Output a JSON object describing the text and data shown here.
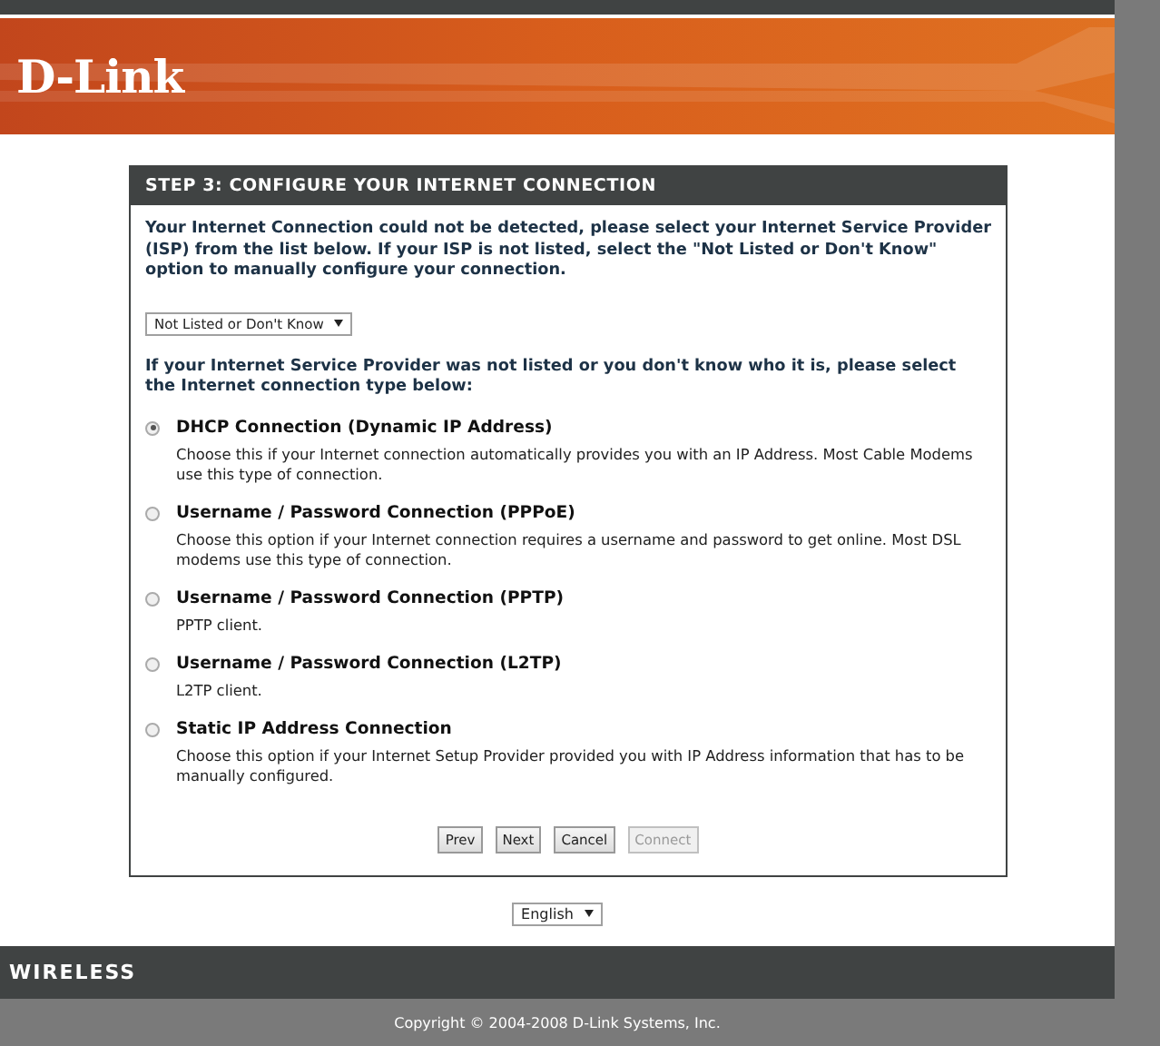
{
  "header": {
    "logo": "D-Link"
  },
  "panel": {
    "title": "STEP 3: CONFIGURE YOUR INTERNET CONNECTION",
    "intro": "Your Internet Connection could not be detected, please select your Internet Service Provider (ISP) from the list below. If your ISP is not listed, select the \"Not Listed or Don't Know\" option to manually configure your connection.",
    "isp_select": {
      "value": "Not Listed or Don't Know"
    },
    "prompt": "If your Internet Service Provider was not listed or you don't know who it is, please select the Internet connection type below:",
    "options": [
      {
        "label": "DHCP Connection (Dynamic IP Address)",
        "description": "Choose this if your Internet connection automatically provides you with an IP Address. Most Cable Modems use this type of connection.",
        "selected": true
      },
      {
        "label": "Username / Password Connection (PPPoE)",
        "description": "Choose this option if your Internet connection requires a username and password to get online. Most DSL modems use this type of connection.",
        "selected": false
      },
      {
        "label": "Username / Password Connection (PPTP)",
        "description": "PPTP client.",
        "selected": false
      },
      {
        "label": "Username / Password Connection (L2TP)",
        "description": "L2TP client.",
        "selected": false
      },
      {
        "label": "Static IP Address Connection",
        "description": "Choose this option if your Internet Setup Provider provided you with IP Address information that has to be manually configured.",
        "selected": false
      }
    ],
    "buttons": [
      {
        "label": "Prev",
        "disabled": false
      },
      {
        "label": "Next",
        "disabled": false
      },
      {
        "label": "Cancel",
        "disabled": false
      },
      {
        "label": "Connect",
        "disabled": true
      }
    ]
  },
  "language_select": {
    "value": "English"
  },
  "footer": {
    "brand": "WIRELESS",
    "copyright": "Copyright © 2004-2008 D-Link Systems, Inc."
  }
}
